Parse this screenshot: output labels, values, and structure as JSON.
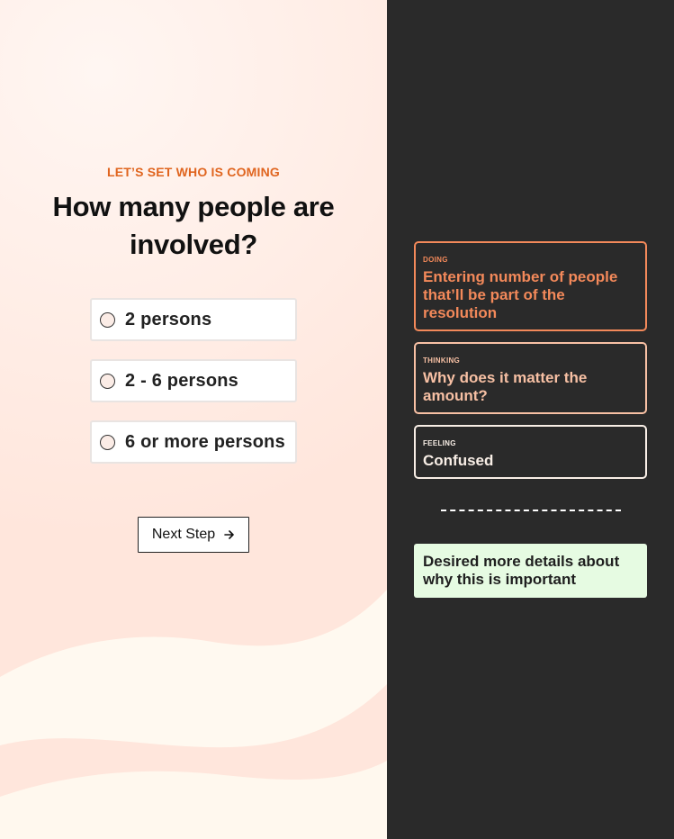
{
  "colors": {
    "accent_orange": "#e0651f",
    "card_orange": "#f3895a",
    "card_peach": "#f7c0a4",
    "card_cream": "#f8eee6",
    "dark_bg": "#2a2a2a",
    "note_green": "#e6fbe2"
  },
  "form": {
    "eyebrow": "LET’S SET WHO IS COMING",
    "question": "How many people are involved?",
    "options": [
      {
        "label": "2 persons",
        "selected": false
      },
      {
        "label": "2 - 6 persons",
        "selected": false
      },
      {
        "label": "6 or more persons",
        "selected": false
      }
    ],
    "next_label": "Next Step",
    "next_icon": "arrow-right-icon"
  },
  "journey": {
    "doing": {
      "label": "DOING",
      "text": "Entering number of people that’ll be part of the resolution"
    },
    "thinking": {
      "label": "THINKING",
      "text": "Why does it matter the amount?"
    },
    "feeling": {
      "label": "FEELING",
      "text": "Confused"
    },
    "insight": "Desired more details about why this is important"
  }
}
